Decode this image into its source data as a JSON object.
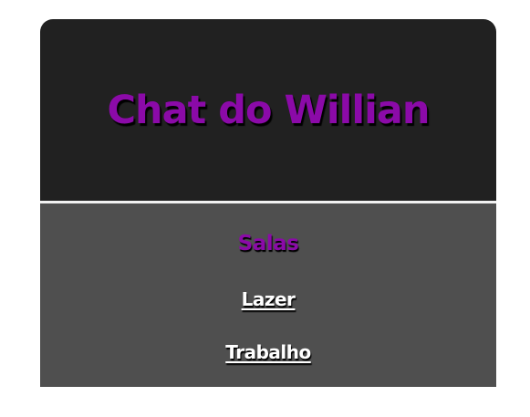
{
  "header": {
    "title": "Chat do Willian"
  },
  "rooms": {
    "heading": "Salas",
    "items": [
      {
        "label": "Lazer"
      },
      {
        "label": "Trabalho"
      }
    ]
  },
  "colors": {
    "accent": "#8b0aa8",
    "header_bg": "#212121",
    "rooms_bg": "#4f4f4f",
    "link": "#ffffff"
  }
}
